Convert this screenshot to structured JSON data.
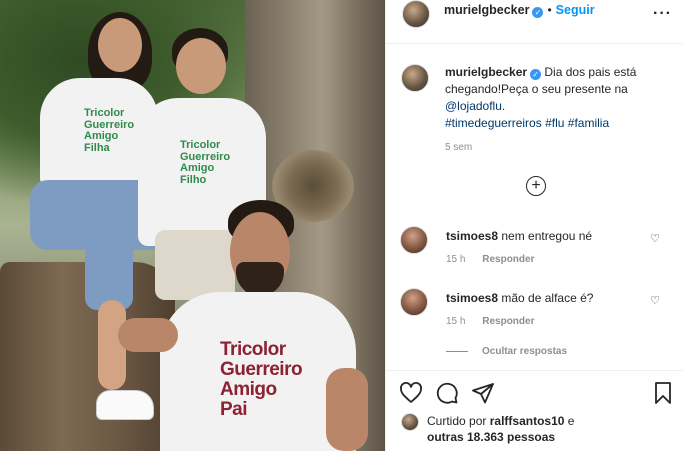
{
  "post": {
    "username": "murielgbecker",
    "follow_label": "Seguir",
    "dot": "•",
    "caption_username": "murielgbecker",
    "caption_text_1": "Dia dos pais está chegando!Peça o seu presente na",
    "caption_mention": "@lojadoflu",
    "caption_period": ".",
    "hashtags": [
      "#timedeguerreiros",
      "#flu",
      "#familia"
    ],
    "time_ago": "5 sem"
  },
  "photo": {
    "shirt_green_lines": [
      "Tricolor",
      "Guerreiro",
      "Amigo",
      "Filha"
    ],
    "shirt_green2_lines": [
      "Tricolor",
      "Guerreiro",
      "Amigo",
      "Filho"
    ],
    "shirt_maroon_lines": [
      "Tricolor",
      "Guerreiro",
      "Amigo",
      "Pai"
    ]
  },
  "comments": [
    {
      "username": "tsimoes8",
      "text": "nem entregou né",
      "time": "15 h",
      "reply": "Responder"
    },
    {
      "username": "tsimoes8",
      "text": "mão de alface é?",
      "time": "15 h",
      "reply": "Responder"
    }
  ],
  "hide_replies_label": "Ocultar respostas",
  "likes": {
    "prefix": "Curtido por",
    "user": "ralffsantos10",
    "conj": "e",
    "others": "outras 18.363 pessoas"
  },
  "icons": {
    "more": "more-options-icon",
    "verified": "verified-badge-icon",
    "heart": "heart-icon",
    "comment": "comment-icon",
    "share": "share-icon",
    "save": "bookmark-icon",
    "load_more": "plus-circle-icon"
  },
  "colors": {
    "link": "#00376b",
    "follow": "#0095f6",
    "verified": "#3897f0"
  }
}
